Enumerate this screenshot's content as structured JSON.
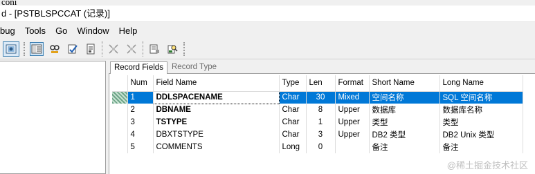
{
  "window": {
    "top_cut_text": "coni",
    "title": "d - [PSTBLSPCCAT (记录)]"
  },
  "menu": {
    "items": [
      "bug",
      "Tools",
      "Go",
      "Window",
      "Help"
    ]
  },
  "tabs": {
    "record_fields": "Record Fields",
    "record_type": "Record Type"
  },
  "table": {
    "columns": [
      "Num",
      "Field Name",
      "Type",
      "Len",
      "Format",
      "Short Name",
      "Long Name"
    ],
    "rows": [
      {
        "num": "1",
        "field": "DDLSPACENAME",
        "type": "Char",
        "len": "30",
        "format": "Mixed",
        "short": "空间名称",
        "long": "SQL 空间名称",
        "bold": true,
        "selected": true
      },
      {
        "num": "2",
        "field": "DBNAME",
        "type": "Char",
        "len": "8",
        "format": "Upper",
        "short": "数据库",
        "long": "数据库名称",
        "bold": true,
        "selected": false
      },
      {
        "num": "3",
        "field": "TSTYPE",
        "type": "Char",
        "len": "1",
        "format": "Upper",
        "short": "类型",
        "long": "类型",
        "bold": true,
        "selected": false
      },
      {
        "num": "4",
        "field": "DBXTSTYPE",
        "type": "Char",
        "len": "3",
        "format": "Upper",
        "short": "DB2 类型",
        "long": "DB2 Unix 类型",
        "bold": false,
        "selected": false
      },
      {
        "num": "5",
        "field": "COMMENTS",
        "type": "Long",
        "len": "0",
        "format": "",
        "short": "备注",
        "long": "备注",
        "bold": false,
        "selected": false
      }
    ]
  },
  "watermark": "@稀土掘金技术社区",
  "colors": {
    "selection": "#0078d7",
    "background": "#f0f0f0"
  }
}
